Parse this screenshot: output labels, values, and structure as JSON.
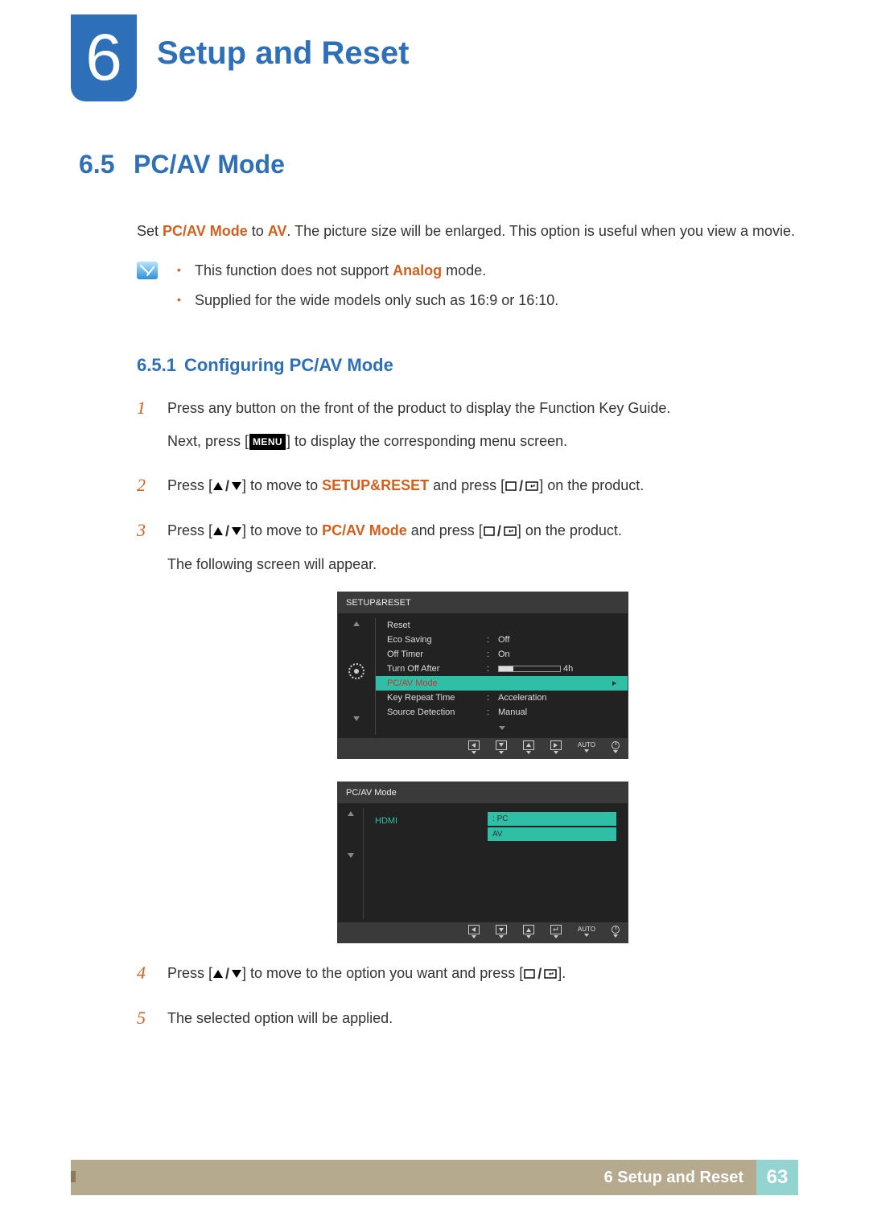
{
  "chapter": {
    "number": "6",
    "title": "Setup and Reset"
  },
  "section": {
    "number": "6.5",
    "title": "PC/AV Mode"
  },
  "intro": {
    "prefix": "Set ",
    "bold1": "PC/AV Mode",
    "mid": " to ",
    "bold2": "AV",
    "suffix": ". The picture size will be enlarged. This option is useful when you view a movie."
  },
  "notes": [
    {
      "pre": "This function does not support ",
      "bold": "Analog",
      "post": " mode."
    },
    {
      "pre": "Supplied for the wide models only such as 16:9 or 16:10.",
      "bold": "",
      "post": ""
    }
  ],
  "subsection": {
    "number": "6.5.1",
    "title": "Configuring PC/AV Mode"
  },
  "steps": {
    "s1_a": "Press any button on the front of the product to display the Function Key Guide.",
    "s1_b_pre": "Next, press [",
    "s1_b_menu": "MENU",
    "s1_b_post": "] to display the corresponding menu screen.",
    "s2_pre": "Press [",
    "s2_mid": "] to move to ",
    "s2_bold": "SETUP&RESET",
    "s2_post1": " and press [",
    "s2_post2": "] on the product.",
    "s3_pre": "Press [",
    "s3_mid": "] to move to ",
    "s3_bold": "PC/AV Mode",
    "s3_post1": " and press [",
    "s3_post2": "] on the product.",
    "s3_tail": "The following screen will appear.",
    "s4_pre": "Press [",
    "s4_mid": "] to move to the option you want and press [",
    "s4_post": "].",
    "s5": "The selected option will be applied."
  },
  "osd1": {
    "title": "SETUP&RESET",
    "rows": [
      {
        "label": "Reset",
        "value": ""
      },
      {
        "label": "Eco Saving",
        "value": "Off"
      },
      {
        "label": "Off Timer",
        "value": "On"
      },
      {
        "label": "Turn Off After",
        "value": "4h",
        "bar": true
      },
      {
        "label": "PC/AV Mode",
        "value": "",
        "hl": true
      },
      {
        "label": "Key Repeat Time",
        "value": "Acceleration"
      },
      {
        "label": "Source Detection",
        "value": "Manual"
      }
    ],
    "auto": "AUTO"
  },
  "osd2": {
    "title": "PC/AV Mode",
    "source": "HDMI",
    "opts": [
      "PC",
      "AV"
    ],
    "auto": "AUTO"
  },
  "footer": {
    "chapter_label": "6 Setup and Reset",
    "page": "63"
  }
}
